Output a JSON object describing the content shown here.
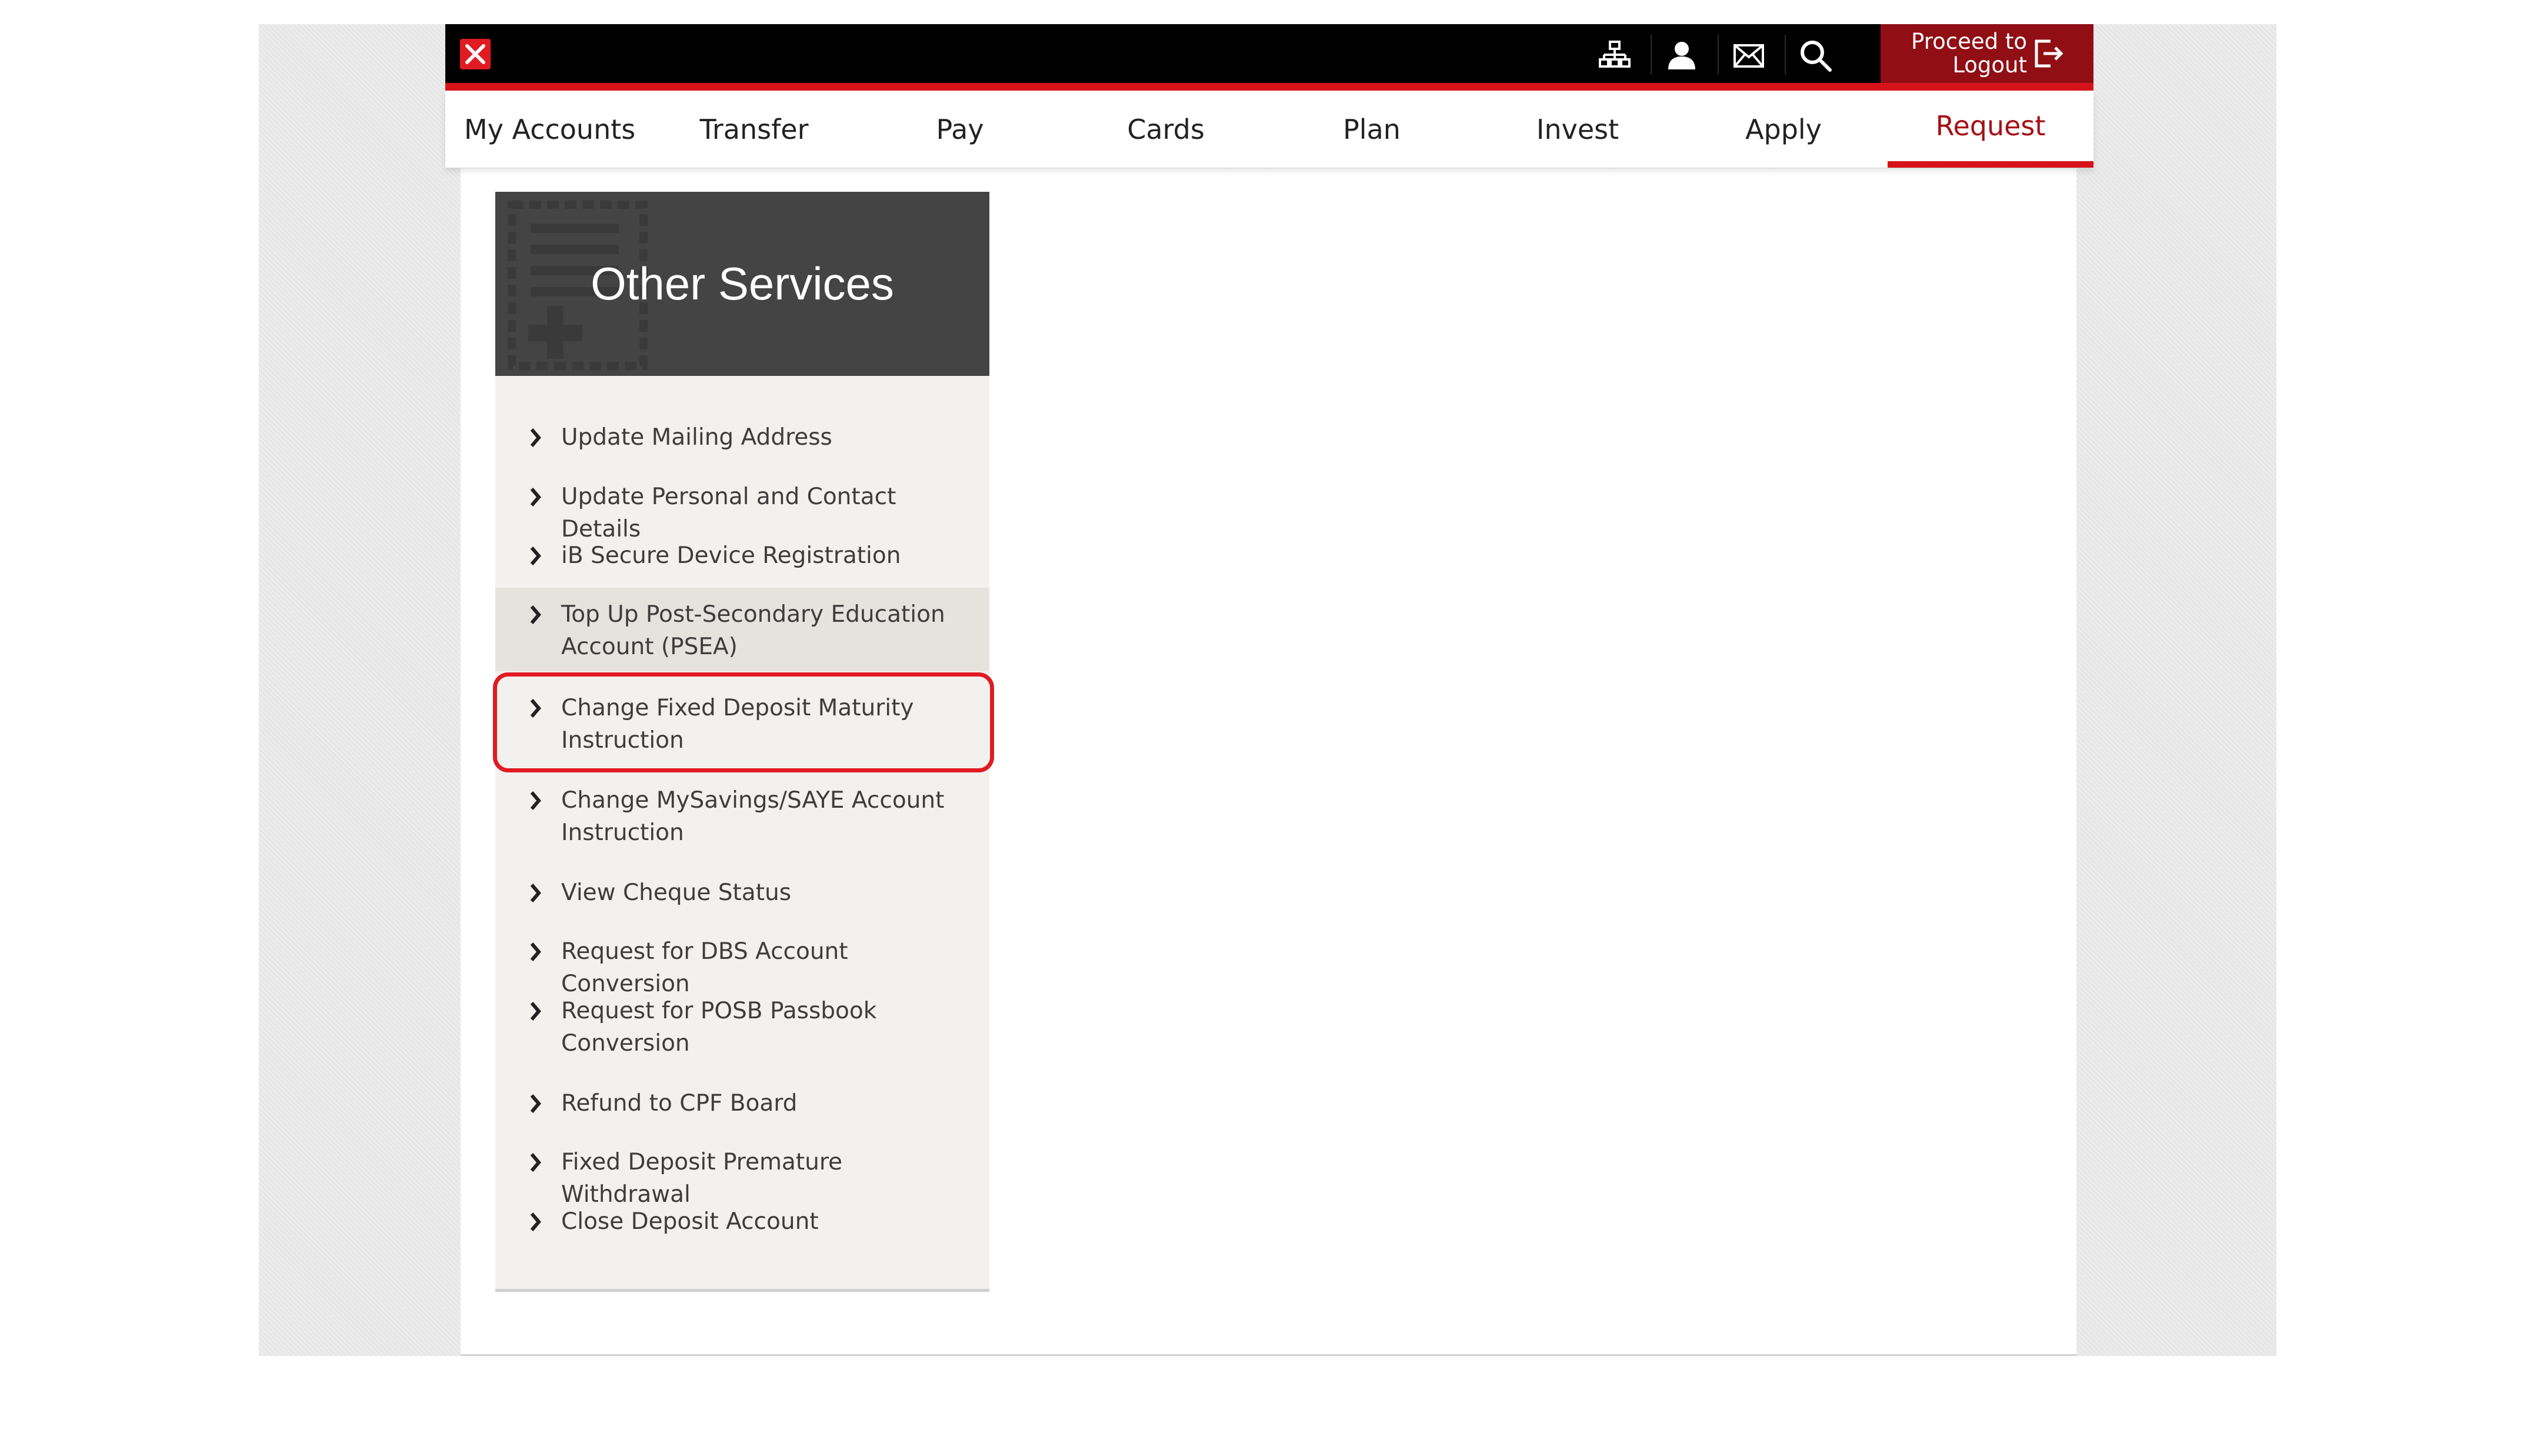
{
  "header": {
    "icons": [
      "sitemap-icon",
      "user-icon",
      "mail-icon",
      "search-icon"
    ],
    "logout_label": "Proceed to Logout"
  },
  "nav": {
    "items": [
      {
        "label": "My Accounts"
      },
      {
        "label": "Transfer"
      },
      {
        "label": "Pay"
      },
      {
        "label": "Cards"
      },
      {
        "label": "Plan"
      },
      {
        "label": "Invest"
      },
      {
        "label": "Apply"
      },
      {
        "label": "Request"
      }
    ],
    "active": "Request"
  },
  "sidebar": {
    "title": "Other Services",
    "items": [
      {
        "label": "Update Mailing Address"
      },
      {
        "label": "Update Personal and Contact Details"
      },
      {
        "label": "iB Secure Device Registration"
      },
      {
        "label": "Top Up Post-Secondary Education Account (PSEA)"
      },
      {
        "label": "Change Fixed Deposit Maturity Instruction"
      },
      {
        "label": "Change MySavings/SAYE Account Instruction"
      },
      {
        "label": "View Cheque Status"
      },
      {
        "label": "Request for DBS Account Conversion"
      },
      {
        "label": "Request for POSB Passbook Conversion"
      },
      {
        "label": "Refund to CPF Board"
      },
      {
        "label": "Fixed Deposit Premature Withdrawal"
      },
      {
        "label": "Close Deposit Account"
      }
    ]
  },
  "colors": {
    "brand_red": "#d7131a",
    "logout_bg": "#900e14",
    "active_text": "#a60f14",
    "sidebar_header_bg": "#444444",
    "sidebar_bg": "#f3f1ee",
    "highlight": "#e11b22"
  }
}
